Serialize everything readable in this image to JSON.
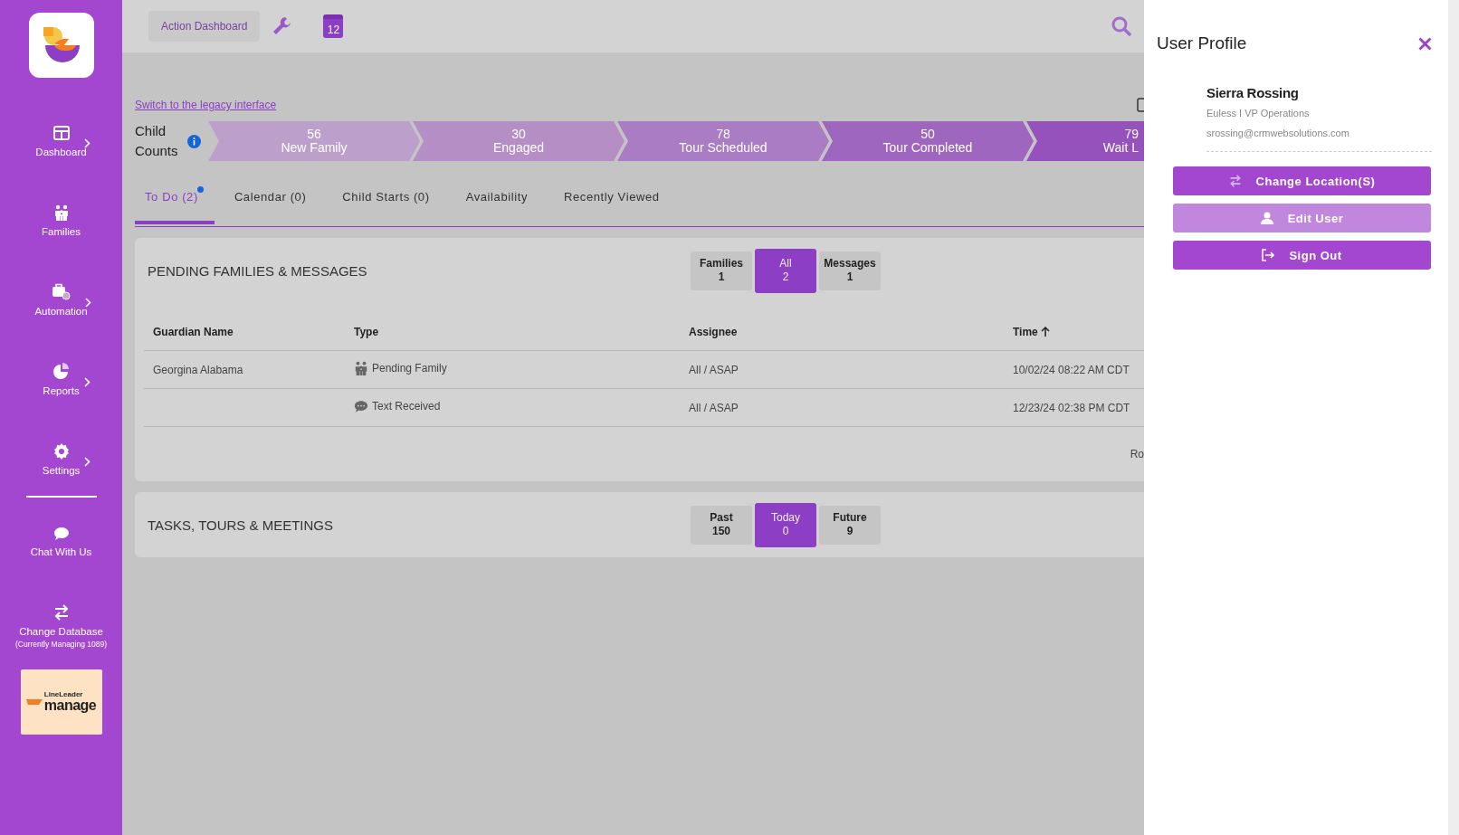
{
  "sidebar": {
    "items": [
      {
        "label": "Dashboard",
        "submenu": true
      },
      {
        "label": "Families",
        "submenu": false
      },
      {
        "label": "Automation",
        "submenu": true
      },
      {
        "label": "Reports",
        "submenu": true
      },
      {
        "label": "Settings",
        "submenu": true
      },
      {
        "label": "Chat With Us",
        "submenu": false
      },
      {
        "label": "Change Database",
        "note": "(Currently Managing 1089)",
        "submenu": false
      }
    ],
    "brand": {
      "small": "LineLeader",
      "name": "manage"
    }
  },
  "top_bar": {
    "button": "Action Dashboard",
    "calendar_day": "12"
  },
  "legacy_link": "Switch to the legacy interface",
  "child_counts": {
    "label": "Child Counts",
    "stages": [
      {
        "count": "56",
        "label": "New Family"
      },
      {
        "count": "30",
        "label": "Engaged"
      },
      {
        "count": "78",
        "label": "Tour Scheduled"
      },
      {
        "count": "50",
        "label": "Tour Completed"
      },
      {
        "count": "79",
        "label": "Wait L"
      }
    ]
  },
  "tabs": [
    {
      "label": "To Do (2)",
      "selected": true,
      "dot": true
    },
    {
      "label": "Calendar (0)",
      "selected": false,
      "dot": false
    },
    {
      "label": "Child Starts (0)",
      "selected": false,
      "dot": false
    },
    {
      "label": "Availability",
      "selected": false,
      "dot": false
    },
    {
      "label": "Recently Viewed",
      "selected": false,
      "dot": false
    }
  ],
  "pending": {
    "title": "PENDING FAMILIES & MESSAGES",
    "filters": [
      {
        "label": "Families",
        "count": "1",
        "selected": false
      },
      {
        "label": "All",
        "count": "2",
        "selected": true
      },
      {
        "label": "Messages",
        "count": "1",
        "selected": false
      }
    ],
    "columns": [
      "Guardian Name",
      "Type",
      "Assignee",
      "Time"
    ],
    "rows": [
      {
        "guardian": "Georgina Alabama",
        "type": "Pending Family",
        "kind": "family",
        "assignee": "All / ASAP",
        "time": "10/02/24 08:22 AM CDT"
      },
      {
        "guardian": "",
        "type": "Text Received",
        "kind": "message",
        "assignee": "All / ASAP",
        "time": "12/23/24 02:38 PM CDT"
      }
    ],
    "footer": "Ro"
  },
  "tasks": {
    "title": "TASKS, TOURS & MEETINGS",
    "filters": [
      {
        "label": "Past",
        "count": "150",
        "selected": false
      },
      {
        "label": "Today",
        "count": "0",
        "selected": true
      },
      {
        "label": "Future",
        "count": "9",
        "selected": false
      }
    ]
  },
  "profile": {
    "title": "User Profile",
    "name": "Sierra Rossing",
    "role": "Euless I VP Operations",
    "email": "srossing@crmwebsolutions.com",
    "actions": [
      {
        "label": "Change Location(S)",
        "kind": "location",
        "hovered": false
      },
      {
        "label": "Edit User",
        "kind": "edit",
        "hovered": true
      },
      {
        "label": "Sign Out",
        "kind": "signout",
        "hovered": false
      }
    ]
  }
}
